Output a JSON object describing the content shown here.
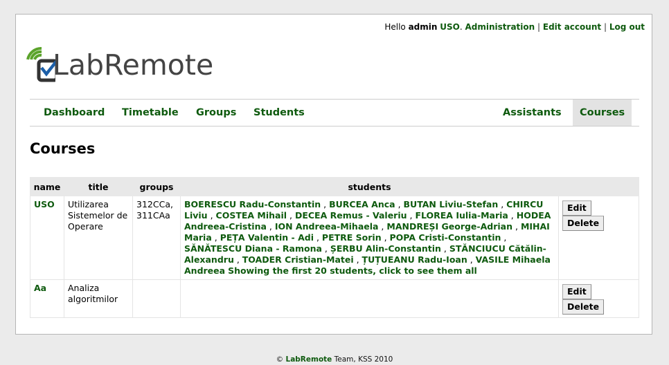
{
  "userbar": {
    "hello": "Hello",
    "username": "admin",
    "course": "USO",
    "administration": "Administration",
    "edit_account": "Edit account",
    "log_out": "Log out"
  },
  "logo": {
    "text": "LabRemote"
  },
  "nav": {
    "left": [
      "Dashboard",
      "Timetable",
      "Groups",
      "Students"
    ],
    "right": [
      "Assistants",
      "Courses"
    ],
    "active": "Courses"
  },
  "page_title": "Courses",
  "table": {
    "headers": [
      "name",
      "title",
      "groups",
      "students"
    ],
    "rows": [
      {
        "name": "USO",
        "title": "Utilizarea Sistemelor de Operare",
        "groups": "312CCa, 311CAa",
        "students": [
          "BOERESCU Radu-Constantin",
          "BURCEA Anca",
          "BUTAN Liviu-Stefan",
          "CHIRCU Liviu",
          "COSTEA Mihail",
          "DECEA Remus - Valeriu",
          "FLOREA Iulia-Maria",
          "HODEA Andreea-Cristina",
          "ION Andreea-Mihaela",
          "MANDREȘI George-Adrian",
          "MIHAI Maria",
          "PEȚA Valentin - Adi",
          "PETRE Sorin",
          "POPA Cristi-Constantin",
          "SĂNĂTESCU Diana - Ramona",
          "ȘERBU Alin-Constantin",
          "STĂNCIUCU Cătălin-Alexandru",
          "TOADER Cristian-Matei",
          "ȚUȚUEANU Radu-Ioan",
          "VASILE Mihaela Andreea"
        ],
        "more_link": "Showing the first 20 students, click to see them all",
        "edit": "Edit",
        "delete": "Delete"
      },
      {
        "name": "Aa",
        "title": "Analiza algoritmilor",
        "groups": "",
        "students": [],
        "more_link": "",
        "edit": "Edit",
        "delete": "Delete"
      }
    ]
  },
  "footer": {
    "copyright": "©",
    "brand": "LabRemote",
    "rest": "Team, KSS 2010"
  },
  "colors": {
    "link": "#0e5a0e",
    "page_bg": "#ebebeb"
  }
}
